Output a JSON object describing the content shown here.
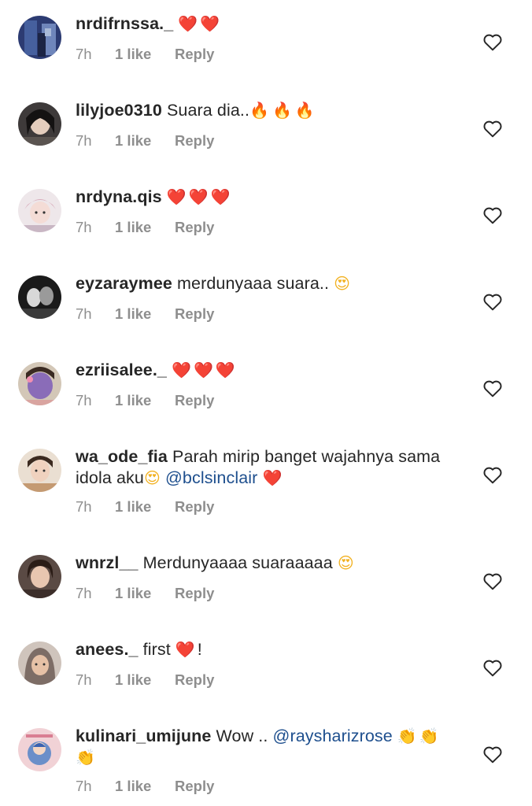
{
  "meta_labels": {
    "time": "7h",
    "likes": "1 like",
    "reply": "Reply"
  },
  "comments": [
    {
      "username": "nrdifrnssa._",
      "segments": [
        {
          "text": "❤️❤️",
          "kind": "heart"
        }
      ]
    },
    {
      "username": "lilyjoe0310",
      "segments": [
        {
          "text": "Suara dia..",
          "kind": "text"
        },
        {
          "text": "🔥🔥🔥",
          "kind": "fire"
        }
      ]
    },
    {
      "username": "nrdyna.qis",
      "segments": [
        {
          "text": "❤️❤️❤️",
          "kind": "heart"
        }
      ]
    },
    {
      "username": "eyzaraymee",
      "segments": [
        {
          "text": "merdunyaaa suara..",
          "kind": "text"
        },
        {
          "text": "😍",
          "kind": "face"
        }
      ]
    },
    {
      "username": "ezriisalee._",
      "segments": [
        {
          "text": "❤️❤️❤️",
          "kind": "heart"
        }
      ]
    },
    {
      "username": "wa_ode_fia",
      "segments": [
        {
          "text": "Parah mirip banget wajahnya sama idola aku",
          "kind": "text"
        },
        {
          "text": "😍",
          "kind": "face"
        },
        {
          "text": "@bclsinclair",
          "kind": "mention"
        },
        {
          "text": "❤️",
          "kind": "heart"
        }
      ]
    },
    {
      "username": "wnrzl__",
      "segments": [
        {
          "text": "Merdunyaaaa suaraaaaa",
          "kind": "text"
        },
        {
          "text": "😍",
          "kind": "face"
        }
      ]
    },
    {
      "username": "anees._",
      "segments": [
        {
          "text": "first",
          "kind": "text"
        },
        {
          "text": "❤️",
          "kind": "heart"
        },
        {
          "text": "!",
          "kind": "text"
        }
      ]
    },
    {
      "username": "kulinari_umijune",
      "segments": [
        {
          "text": "Wow ..",
          "kind": "text"
        },
        {
          "text": "@raysharizrose",
          "kind": "mention"
        },
        {
          "text": "👏👏👏",
          "kind": "clap"
        }
      ]
    }
  ],
  "colors": {
    "username": "#262626",
    "meta": "#8e8e8e",
    "mention": "#1e4f8e",
    "heart_outline": "#262626",
    "heart_emoji": "#e0222f"
  },
  "icons": {
    "like": "heart-outline-icon",
    "avatar": "profile-photo"
  }
}
